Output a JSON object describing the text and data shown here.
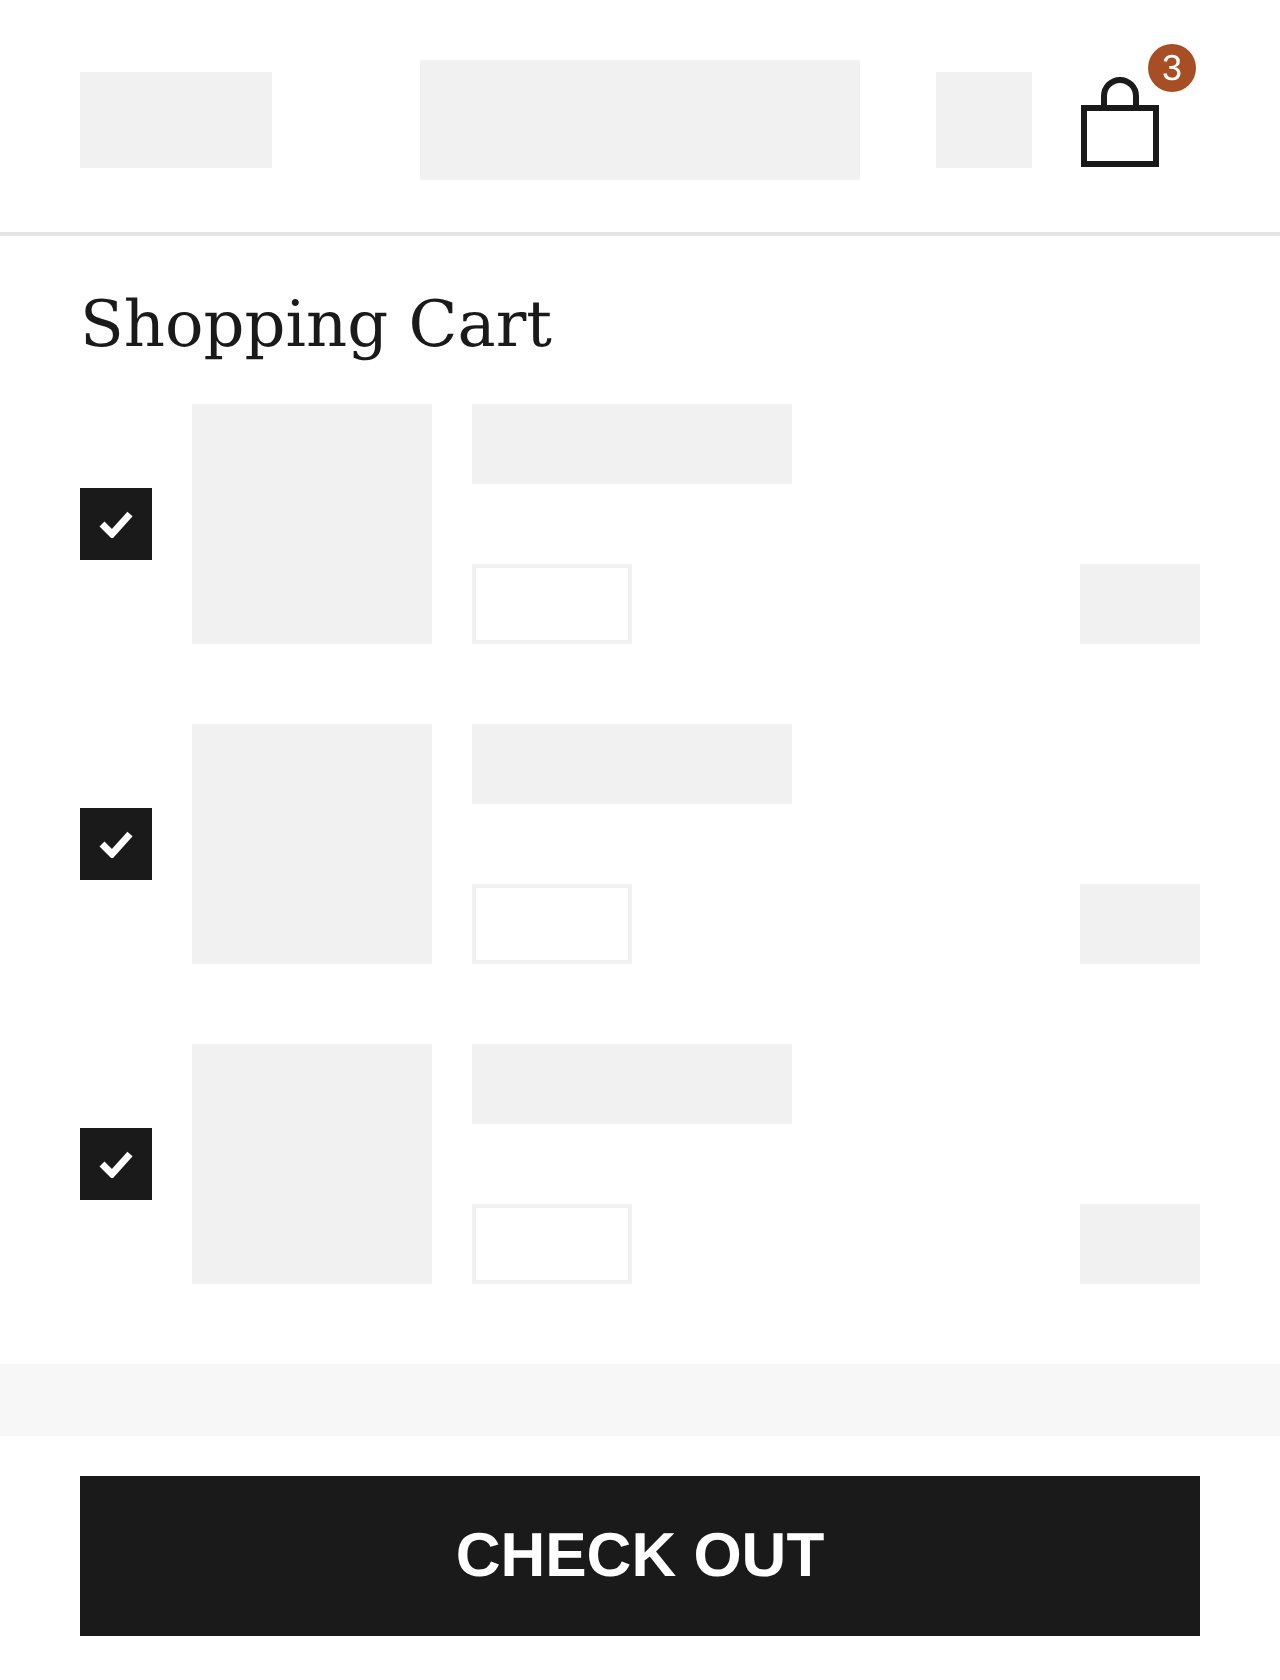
{
  "header": {
    "cart_count": "3"
  },
  "title": "Shopping Cart",
  "items": [
    {
      "checked": true
    },
    {
      "checked": true
    },
    {
      "checked": true
    }
  ],
  "checkout_button": "CHECK OUT"
}
